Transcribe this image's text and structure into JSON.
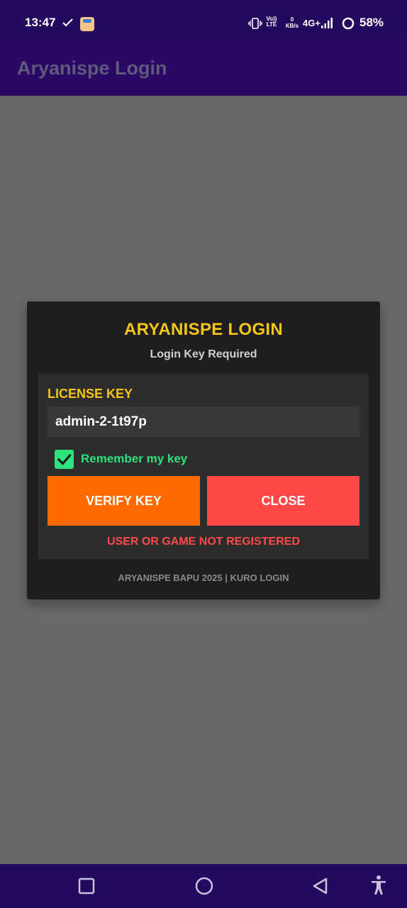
{
  "status_bar": {
    "time": "13:47",
    "volte_line1": "Vo))",
    "volte_line2": "LTE",
    "speed_value": "0",
    "speed_unit": "KB/s",
    "network": "4G+",
    "battery": "58%"
  },
  "app_bar": {
    "title": "Aryanispe Login"
  },
  "dialog": {
    "title": "ARYANISPE LOGIN",
    "subtitle": "Login Key Required",
    "license_label": "LICENSE KEY",
    "license_value": "admin-2-1t97p",
    "remember_label": "Remember my key",
    "remember_checked": true,
    "verify_label": "VERIFY KEY",
    "close_label": "CLOSE",
    "error_text": "USER OR GAME NOT REGISTERED",
    "footer": "ARYANISPE BAPU 2025 | KURO LOGIN"
  },
  "colors": {
    "status_bar_bg": "#240a5e",
    "app_bar_bg": "#2a0966",
    "scrim": "#696969",
    "dialog_bg": "#1e1e1e",
    "accent_yellow": "#f5c518",
    "verify_orange": "#ff6a00",
    "close_red": "#ff4949",
    "check_green": "#2ee27d"
  },
  "icons": [
    "check-icon",
    "app-notification-icon",
    "vibrate-icon",
    "signal-icon",
    "battery-ring-icon",
    "recents-icon",
    "home-icon",
    "back-icon",
    "accessibility-icon"
  ]
}
